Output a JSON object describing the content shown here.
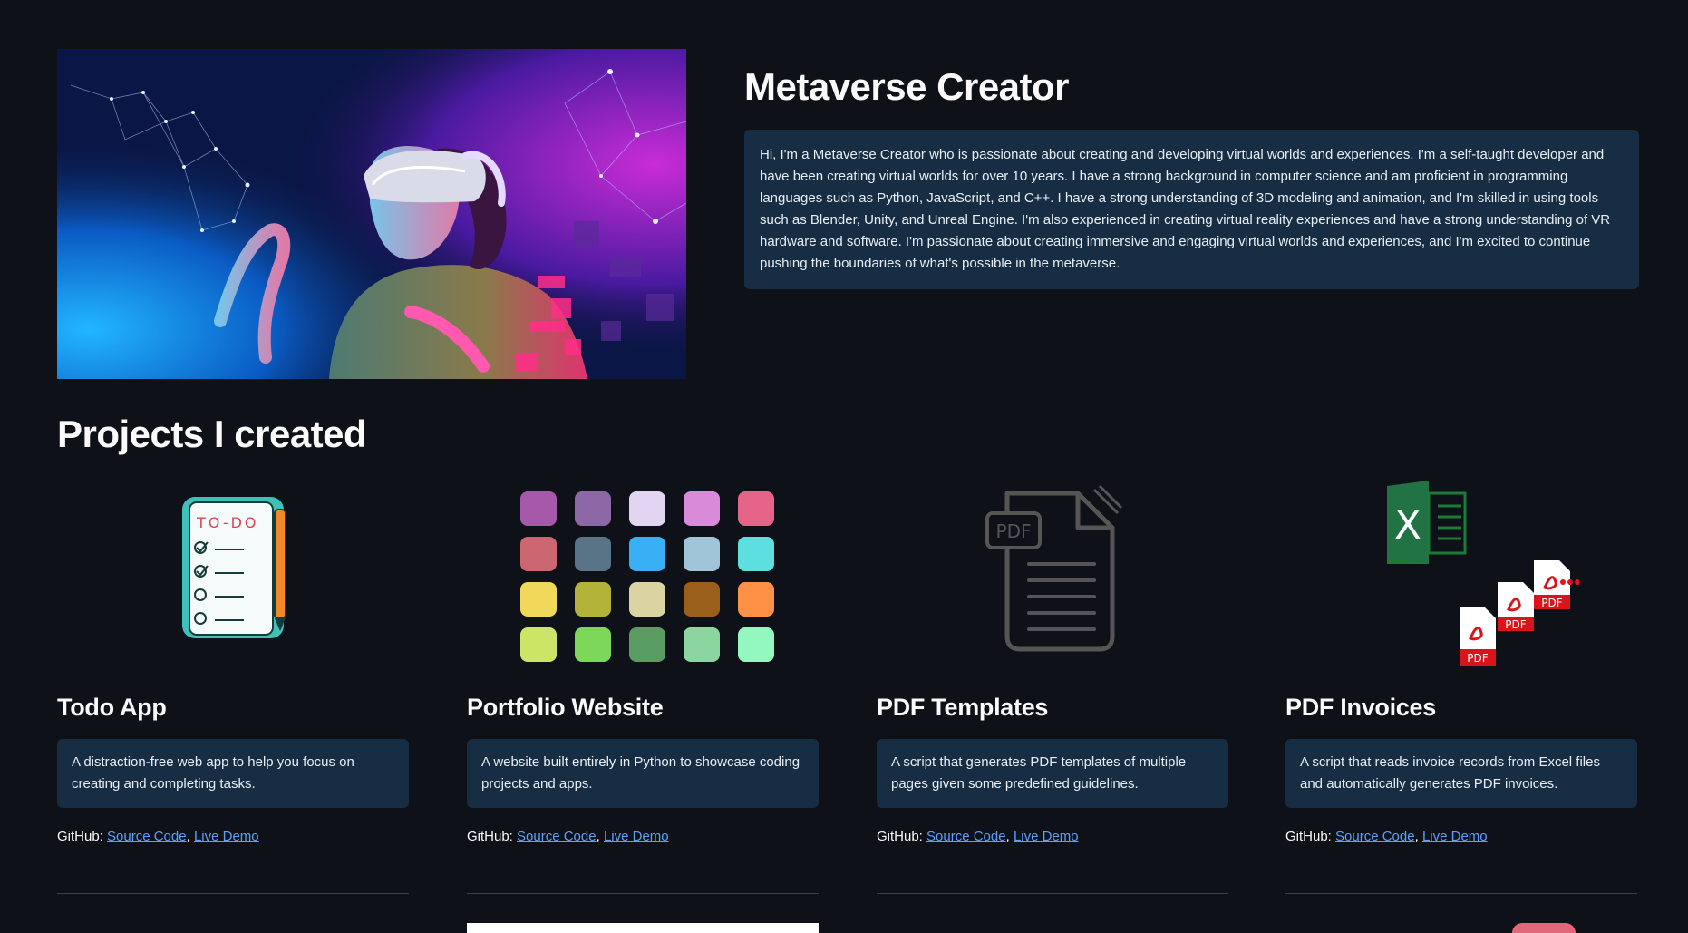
{
  "hero": {
    "title": "Metaverse Creator",
    "bio": "Hi, I'm a Metaverse Creator who is passionate about creating and developing virtual worlds and experiences. I'm a self-taught developer and have been creating virtual worlds for over 10 years. I have a strong background in computer science and am proficient in programming languages such as Python, JavaScript, and C++. I have a strong understanding of 3D modeling and animation, and I'm skilled in using tools such as Blender, Unity, and Unreal Engine. I'm also experienced in creating virtual reality experiences and have a strong understanding of VR hardware and software. I'm passionate about creating immersive and engaging virtual worlds and experiences, and I'm excited to continue pushing the boundaries of what's possible in the metaverse."
  },
  "projects": {
    "heading": "Projects I created",
    "items": [
      {
        "title": "Todo App",
        "description": "A distraction-free web app to help you focus on creating and completing tasks.",
        "github_prefix": "GitHub:",
        "source_label": "Source Code",
        "separator": ",",
        "demo_label": "Live Demo",
        "icon": "todo-list-icon",
        "icon_text": "TO-DO"
      },
      {
        "title": "Portfolio Website",
        "description": "A website built entirely in Python to showcase coding projects and apps.",
        "github_prefix": "GitHub:",
        "source_label": "Source Code",
        "separator": ",",
        "demo_label": "Live Demo",
        "icon": "color-palette-icon",
        "swatches": [
          "#a659a8",
          "#8c68a6",
          "#e3d4f2",
          "#d98ad9",
          "#e66488",
          "#cc6670",
          "#5a7487",
          "#39b0f5",
          "#a0c4d8",
          "#5ddfe0",
          "#f0d85a",
          "#b3b33a",
          "#dcd3a3",
          "#9b5f1c",
          "#ff9147",
          "#cde566",
          "#7dd85a",
          "#5a9c62",
          "#8bd6a0",
          "#93f7c0"
        ]
      },
      {
        "title": "PDF Templates",
        "description": "A script that generates PDF templates of multiple pages given some predefined guidelines.",
        "github_prefix": "GitHub:",
        "source_label": "Source Code",
        "separator": ",",
        "demo_label": "Live Demo",
        "icon": "pdf-document-icon",
        "icon_text": "PDF"
      },
      {
        "title": "PDF Invoices",
        "description": "A script that reads invoice records from Excel files and automatically generates PDF invoices.",
        "github_prefix": "GitHub:",
        "source_label": "Source Code",
        "separator": ",",
        "demo_label": "Live Demo",
        "icon": "excel-to-pdf-icon",
        "icon_text": "PDF",
        "excel_letter": "X"
      }
    ]
  },
  "colors": {
    "background": "#0e1117",
    "card_background": "#172d43",
    "link": "#5aa0ff",
    "text": "#fafafa"
  }
}
